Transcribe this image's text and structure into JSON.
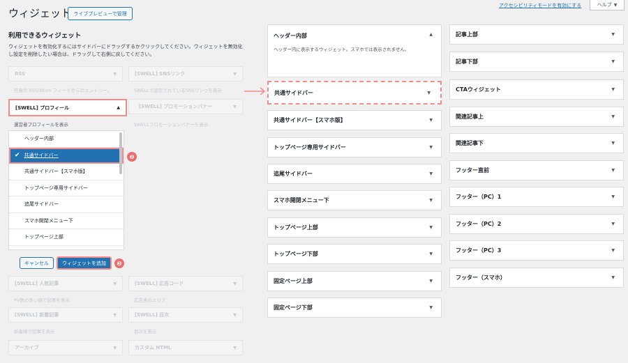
{
  "header": {
    "title": "ウィジェット",
    "manage_button": "ライブプレビューで管理",
    "accessibility_link": "アクセシビリティモードを有効にする",
    "help_tab": "ヘルプ"
  },
  "available": {
    "title": "利用できるウィジェット",
    "description": "ウィジェットを有効化するにはサイドバーにドラッグするかクリックしてください。ウィジェットを無効化し設定を削除したい場合は、ドラッグして右側に戻してください。",
    "widgets": [
      {
        "name": "RSS",
        "desc": "任意の RSS/Atom フィードからのエントリー。"
      },
      {
        "name": "[SWELL] SNSリンク",
        "desc": "SWELLで設定されているSNSリンクを表示"
      },
      {
        "name": "[SWELL] プロモーションバナー",
        "desc": "SWELLプロモーションバナーを表示"
      },
      {
        "name": "[SWELL] 人気記事",
        "desc": "PV数の多い順で記事を表示"
      },
      {
        "name": "[SWELL] 広告コード",
        "desc": "広告表示エリア"
      },
      {
        "name": "[SWELL] 新着記事",
        "desc": "新着順で記事を表示"
      },
      {
        "name": "[SWELL] 目次",
        "desc": "目次を表示"
      },
      {
        "name": "アーカイブ",
        "desc": ""
      },
      {
        "name": "カスタム HTML",
        "desc": ""
      }
    ],
    "expanded": {
      "name": "[SWELL] プロフィール",
      "desc": "運営者プロフィールを表示",
      "sidebar_options": [
        "ヘッダー内部",
        "共通サイドバー",
        "共通サイドバー【スマホ版】",
        "トップページ専用サイドバー",
        "追尾サイドバー",
        "スマホ開閉メニュー下",
        "トップページ上部"
      ],
      "selected_index": 1,
      "cancel": "キャンセル",
      "add": "ウィジェットを追加"
    }
  },
  "badges": [
    "❶",
    "❷",
    "❸"
  ],
  "areas_mid": {
    "header_area": {
      "name": "ヘッダー内部",
      "desc": "ヘッダー内に表示するウィジェット。スマホでは表示されません。"
    },
    "highlight": "共通サイドバー",
    "items": [
      "共通サイドバー【スマホ版】",
      "トップページ専用サイドバー",
      "追尾サイドバー",
      "スマホ開閉メニュー下",
      "トップページ上部",
      "トップページ下部",
      "固定ページ上部",
      "固定ページ下部"
    ]
  },
  "areas_right": [
    "記事上部",
    "記事下部",
    "CTAウィジェット",
    "関連記事上",
    "関連記事下",
    "フッター直前",
    "フッター（PC）1",
    "フッター（PC）2",
    "フッター（PC）3",
    "フッター（スマホ）"
  ],
  "colors": {
    "accent": "#2271b1",
    "highlight": "#f28b8b",
    "badge": "#ec6d6d"
  }
}
